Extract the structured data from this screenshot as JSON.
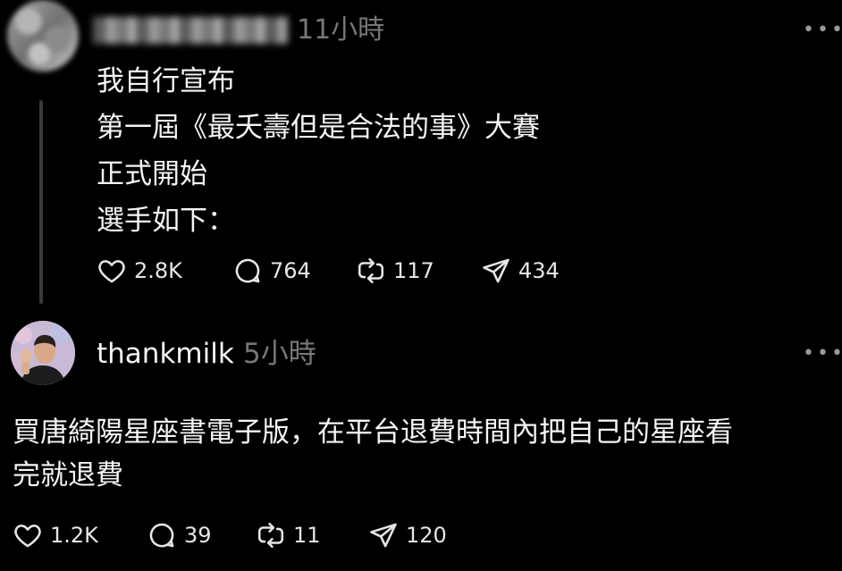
{
  "post": {
    "time": "11小時",
    "more_label": "•••",
    "lines": [
      "我自行宣布",
      "第一屆《最夭壽但是合法的事》大賽",
      "正式開始",
      "選手如下："
    ],
    "likes": "2.8K",
    "comments": "764",
    "reposts": "117",
    "shares": "434"
  },
  "reply": {
    "username": "thankmilk",
    "time": "5小時",
    "more_label": "•••",
    "lines": [
      "買唐綺陽星座書電子版，在平台退費時間內把自己的星座看",
      "完就退費"
    ],
    "likes": "1.2K",
    "comments": "39",
    "reposts": "11",
    "shares": "120"
  },
  "icons": {
    "like": "heart-icon",
    "comment": "comment-bubble-icon",
    "repost": "repost-icon",
    "share": "send-icon"
  },
  "colors": {
    "background": "#000000",
    "text": "#f3f5f7",
    "muted": "#777777",
    "thread_line": "#3a3a3a"
  }
}
